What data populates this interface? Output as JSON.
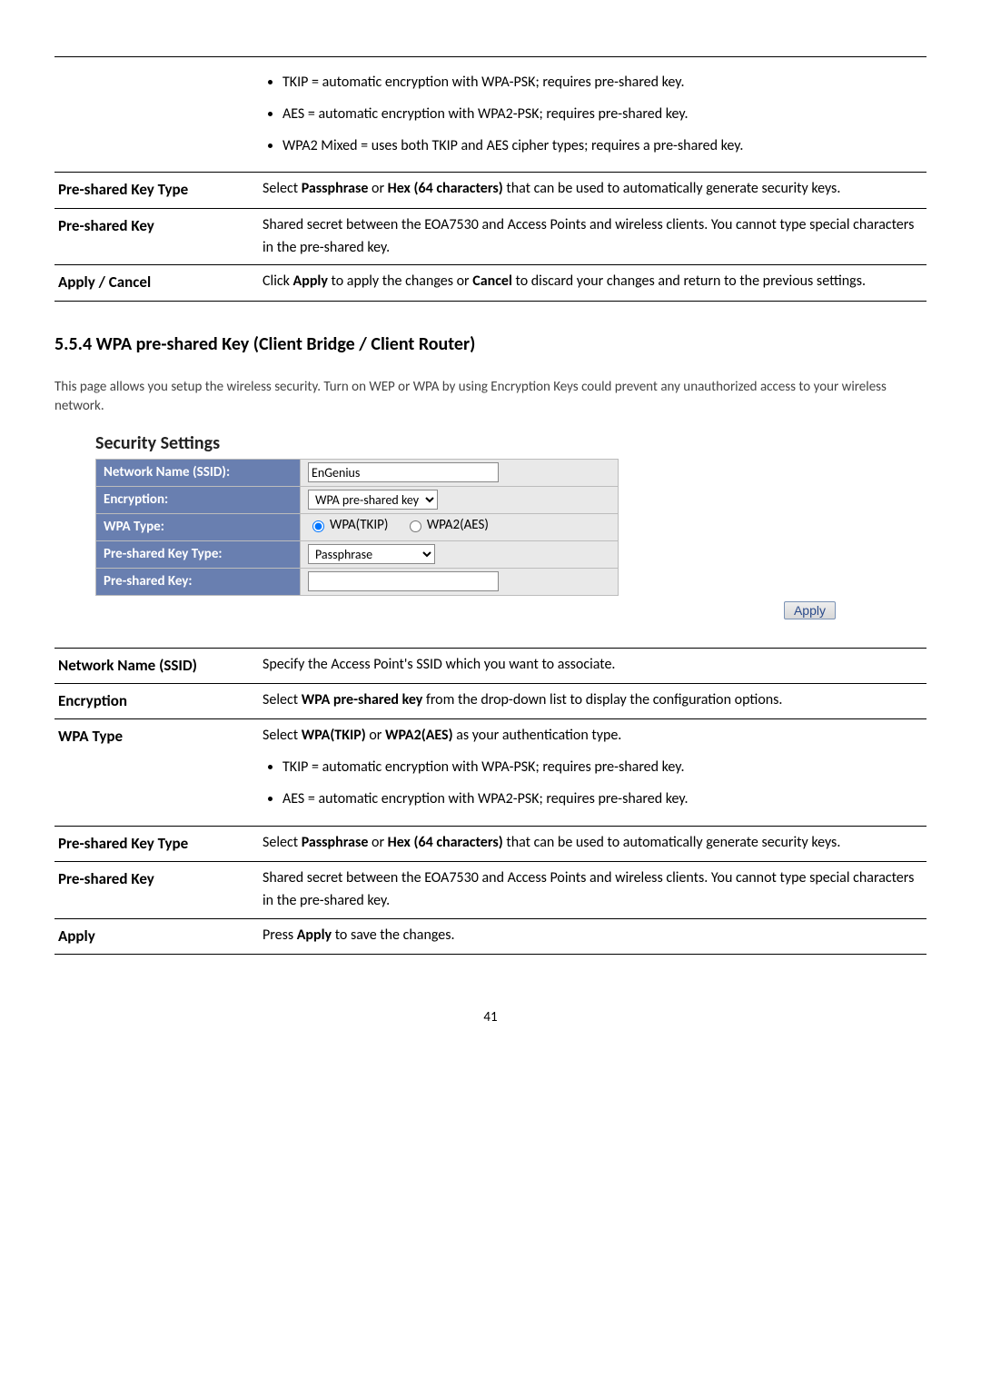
{
  "top_table": {
    "bullets": [
      "TKIP = automatic encryption with WPA-PSK; requires pre-shared key.",
      "AES = automatic encryption with WPA2-PSK; requires pre-shared key.",
      "WPA2 Mixed = uses both TKIP and AES cipher types; requires a pre-shared key."
    ],
    "pskt_label": "Pre-shared Key Type",
    "pskt_text1": "Select ",
    "pskt_bold1": "Passphrase",
    "pskt_text2": " or ",
    "pskt_bold2": "Hex (64 characters)",
    "pskt_text3": " that can be used to automatically generate security keys.",
    "psk_label": "Pre-shared Key",
    "psk_text": "Shared secret between the EOA7530 and Access Points and wireless clients. You cannot type special characters in the pre-shared key.",
    "ac_label": "Apply / Cancel",
    "ac_text1": "Click ",
    "ac_bold1": "Apply",
    "ac_text2": " to apply the changes or ",
    "ac_bold2": "Cancel",
    "ac_text3": " to discard your changes and return to the previous settings."
  },
  "section_heading": "5.5.4 WPA pre-shared Key (Client Bridge / Client Router)",
  "intro": "This page allows you setup the wireless security. Turn on WEP or WPA by using Encryption Keys could prevent any unauthorized access to your wireless network.",
  "form": {
    "heading": "Security Settings",
    "ssid_label": "Network Name (SSID):",
    "ssid_value": "EnGenius",
    "enc_label": "Encryption:",
    "enc_value": "WPA pre-shared key",
    "wpa_label": "WPA Type:",
    "wpa_opt1": "WPA(TKIP)",
    "wpa_opt2": "WPA2(AES)",
    "pskt_label": "Pre-shared Key Type:",
    "pskt_value": "Passphrase",
    "psk_label": "Pre-shared Key:",
    "psk_value": "",
    "apply": "Apply"
  },
  "bottom_table": {
    "nn_label": "Network Name (SSID)",
    "nn_text": "Specify the Access Point's SSID which you want to associate.",
    "enc_label": "Encryption",
    "enc_text1": "Select ",
    "enc_bold": "WPA pre-shared key",
    "enc_text2": " from the drop-down list to display the configuration options.",
    "wpa_label": "WPA Type",
    "wpa_text1": "Select ",
    "wpa_bold1": "WPA(TKIP)",
    "wpa_text2": " or ",
    "wpa_bold2": "WPA2(AES)",
    "wpa_text3": " as your authentication type.",
    "wpa_bul1": "TKIP = automatic encryption with WPA-PSK; requires pre-shared key.",
    "wpa_bul2": "AES = automatic encryption with WPA2-PSK; requires pre-shared key.",
    "pskt_label": "Pre-shared Key Type",
    "pskt_text1": "Select ",
    "pskt_bold1": "Passphrase",
    "pskt_text2": " or ",
    "pskt_bold2": "Hex (64 characters)",
    "pskt_text3": " that can be used to automatically generate security keys.",
    "psk_label": "Pre-shared Key",
    "psk_text": "Shared secret between the EOA7530 and Access Points and wireless clients. You cannot type special characters in the pre-shared key.",
    "apply_label": "Apply",
    "apply_text1": "Press ",
    "apply_bold": "Apply",
    "apply_text2": " to save the changes."
  },
  "page_number": "41"
}
